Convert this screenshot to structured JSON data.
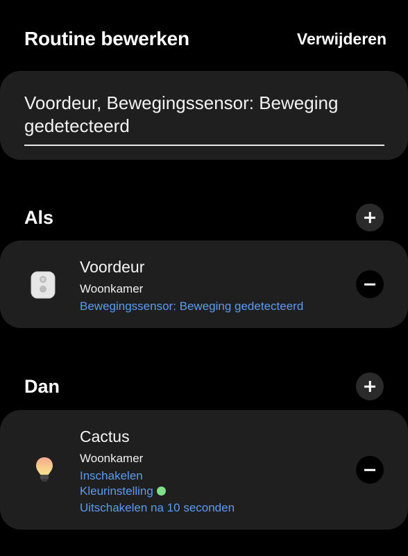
{
  "header": {
    "title": "Routine bewerken",
    "delete_label": "Verwijderen"
  },
  "routine_name": {
    "value": "Voordeur, Bewegingssensor: Beweging gedetecteerd"
  },
  "if_section": {
    "title": "Als",
    "add_icon": "plus-icon",
    "devices": [
      {
        "icon": "motion-sensor-icon",
        "name": "Voordeur",
        "room": "Woonkamer",
        "details": [
          "Bewegingssensor: Beweging gedetecteerd"
        ]
      }
    ]
  },
  "then_section": {
    "title": "Dan",
    "add_icon": "plus-icon",
    "devices": [
      {
        "icon": "light-bulb-icon",
        "name": "Cactus",
        "room": "Woonkamer",
        "details": [
          "Inschakelen",
          "Kleurinstelling",
          "Uitschakelen na 10 seconden"
        ],
        "color_swatch": "#7fe08a"
      }
    ]
  },
  "colors": {
    "background": "#000000",
    "card": "#1f1f1f",
    "link": "#5b9cf0",
    "add_button": "#2a2a2a"
  }
}
